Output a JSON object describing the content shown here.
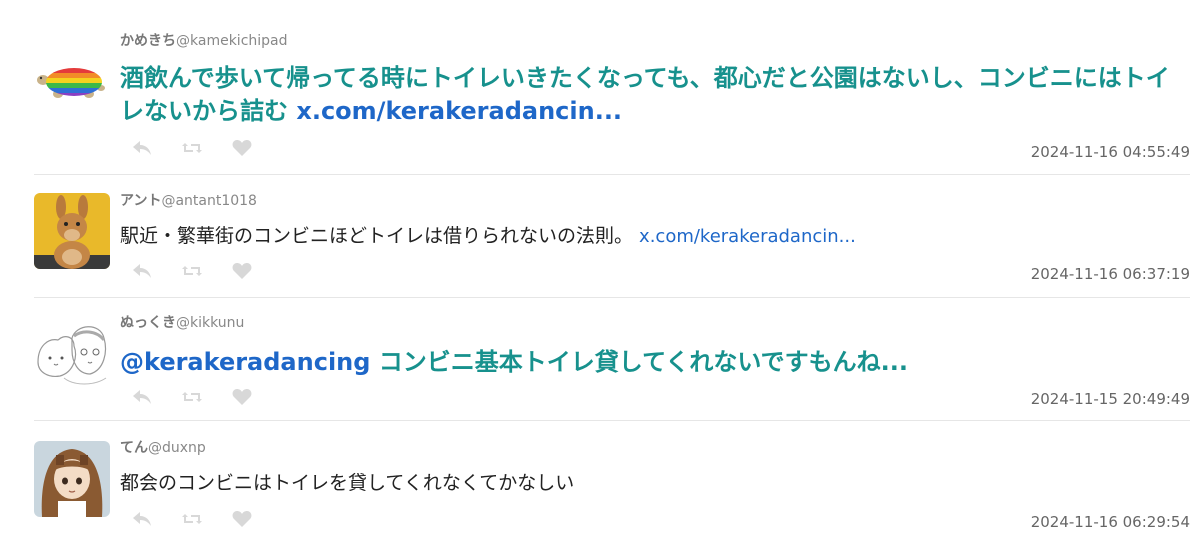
{
  "colors": {
    "big_text": "#17918d",
    "link": "#1e67c8",
    "icon": "#d8d8d8",
    "divider": "#e6e6e6"
  },
  "tweets": [
    {
      "name": "かめきち",
      "handle": "@kamekichipad",
      "text": "酒飲んで歩いて帰ってる時にトイレいきたくなっても、都心だと公園はないし、コンビニにはトイレないから詰む ",
      "link": "x.com/kerakeradancin...",
      "time": "2024-11-16 04:55:49",
      "avatar_icon": "rainbow-turtle-icon"
    },
    {
      "name": "アント",
      "handle": "@antant1018",
      "text": "駅近・繁華街のコンビニほどトイレは借りられないの法則。 ",
      "link": "x.com/kerakeradancin...",
      "time": "2024-11-16 06:37:19",
      "avatar_icon": "kangaroo-plush-icon"
    },
    {
      "name": "ぬっくき",
      "handle": "@kikkunu",
      "mention": "@kerakeradancing",
      "text": " コンビニ基本トイレ貸してくれないですもんね...",
      "time": "2024-11-15 20:49:49",
      "avatar_icon": "sketch-characters-icon"
    },
    {
      "name": "てん",
      "handle": "@duxnp",
      "text": "都会のコンビニはトイレを貸してくれなくてかなしい",
      "time": "2024-11-16 06:29:54",
      "avatar_icon": "anime-girl-icon"
    }
  ],
  "actions": [
    "reply-icon",
    "retweet-icon",
    "like-icon"
  ]
}
